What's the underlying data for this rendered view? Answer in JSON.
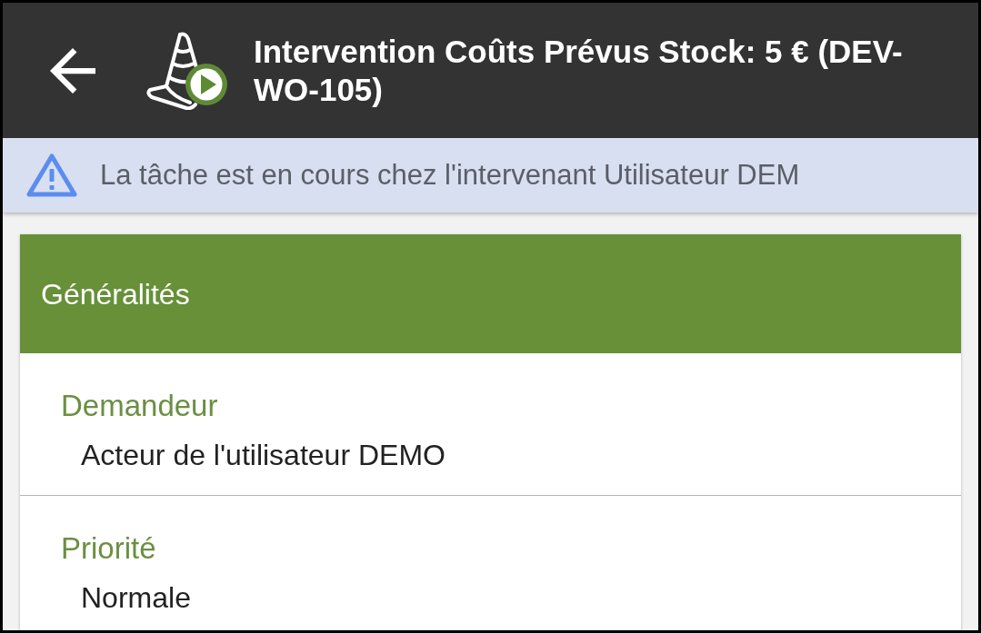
{
  "app_bar": {
    "title": "Intervention Coûts Prévus Stock: 5 € (DEV-WO-105)"
  },
  "alert": {
    "text": "La tâche est en cours chez l'intervenant Utilisateur DEM"
  },
  "section": {
    "title": "Généralités",
    "fields": [
      {
        "label": "Demandeur",
        "value": "Acteur de l'utilisateur DEMO"
      },
      {
        "label": "Priorité",
        "value": "Normale"
      }
    ]
  }
}
